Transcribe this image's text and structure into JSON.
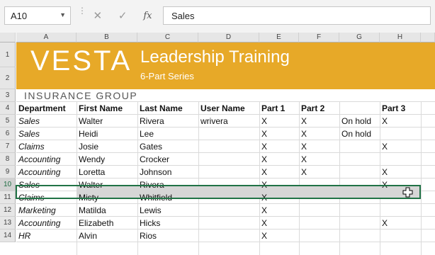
{
  "formula_bar": {
    "name_box": "A10",
    "cancel_glyph": "✕",
    "enter_glyph": "✓",
    "fx_label": "fx",
    "formula_value": "Sales"
  },
  "columns": [
    "A",
    "B",
    "C",
    "D",
    "E",
    "F",
    "G",
    "H"
  ],
  "rows": [
    "1",
    "2",
    "3",
    "4",
    "5",
    "6",
    "7",
    "8",
    "9",
    "10",
    "11",
    "12",
    "13",
    "14"
  ],
  "banner": {
    "logo": "VESTA",
    "title": "Leadership Training",
    "subtitle": "6-Part Series",
    "group": "INSURANCE   GROUP"
  },
  "table": {
    "headers": [
      "Department",
      "First Name",
      "Last Name",
      "User Name",
      "Part 1",
      "Part 2",
      "",
      "Part 3"
    ],
    "rows": [
      [
        "Sales",
        "Walter",
        "Rivera",
        "wrivera",
        "X",
        "X",
        "On hold",
        "X"
      ],
      [
        "Sales",
        "Heidi",
        "Lee",
        "",
        "X",
        "X",
        "On hold",
        ""
      ],
      [
        "Claims",
        "Josie",
        "Gates",
        "",
        "X",
        "X",
        "",
        "X"
      ],
      [
        "Accounting",
        "Wendy",
        "Crocker",
        "",
        "X",
        "X",
        "",
        ""
      ],
      [
        "Accounting",
        "Loretta",
        "Johnson",
        "",
        "X",
        "X",
        "",
        "X"
      ],
      [
        "Sales",
        "Walter",
        "Rivera",
        "",
        "X",
        "",
        "",
        "X"
      ],
      [
        "Claims",
        "Misty",
        "Whitfield",
        "",
        "X",
        "",
        "",
        ""
      ],
      [
        "Marketing",
        "Matilda",
        "Lewis",
        "",
        "X",
        "",
        "",
        ""
      ],
      [
        "Accounting",
        "Elizabeth",
        "Hicks",
        "",
        "X",
        "",
        "",
        "X"
      ],
      [
        "HR",
        "Alvin",
        "Rios",
        "",
        "X",
        "",
        "",
        ""
      ]
    ]
  },
  "selection": {
    "active_cell": "A10",
    "selected_row": "10"
  },
  "colors": {
    "banner": "#e7a928",
    "selection_border": "#217346"
  }
}
